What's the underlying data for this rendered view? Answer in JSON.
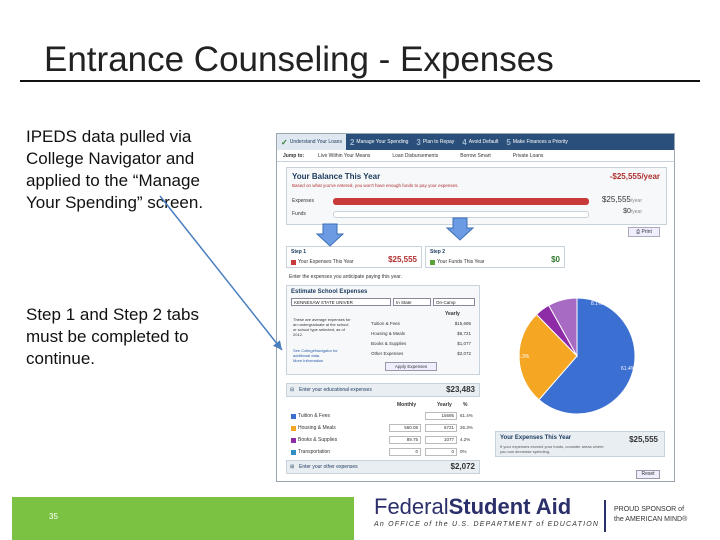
{
  "slide": {
    "title": "Entrance Counseling - Expenses",
    "bullet1": "IPEDS data pulled via College Navigator and applied to the “Manage Your Spending” screen.",
    "bullet2": "Step 1 and Step 2 tabs must be completed to continue.",
    "page_number": "35"
  },
  "footer": {
    "brand_regular": "Federal",
    "brand_bold": "Student Aid",
    "brand_sub": "An OFFICE of the U.S. DEPARTMENT of EDUCATION",
    "sponsor_line1": "PROUD SPONSOR of",
    "sponsor_line2": "the AMERICAN MIND®",
    "green": "#7cc242",
    "navy": "#2b2f6a"
  },
  "screenshot": {
    "steps": [
      {
        "num": "1",
        "label": "Understand Your Loans"
      },
      {
        "num": "2",
        "label": "Manage Your Spending"
      },
      {
        "num": "3",
        "label": "Plan to Repay"
      },
      {
        "num": "4",
        "label": "Avoid Default"
      },
      {
        "num": "5",
        "label": "Make Finances a Priority"
      }
    ],
    "jump": {
      "label": "Jump to:",
      "links": [
        "Live Within Your Means",
        "Loan Disbursements",
        "Borrow Smart",
        "Private Loans"
      ]
    },
    "balance": {
      "title": "Your Balance This Year",
      "subtitle": "Based on what you've entered, you won't have enough funds to pay your expenses.",
      "total": "-$25,555/year",
      "expenses_label": "Expenses",
      "expenses_value": "$25,555",
      "expenses_unit": "/year",
      "funds_label": "Funds",
      "funds_value": "$0",
      "funds_unit": "/year",
      "print": "Print"
    },
    "tabs": {
      "step1_title": "Step 1",
      "step1_label": "Your Expenses This Year",
      "step1_value": "$25,555",
      "step2_title": "Step 2",
      "step2_label": "Your Funds This Year",
      "step2_value": "$0",
      "instructions": "Enter the expenses you anticipate paying this year."
    },
    "estimate": {
      "title": "Estimate School Expenses",
      "school": "KENNESAW STATE UNIVER",
      "residency": "In State",
      "housing": "On-Camp",
      "yearly_header": "Yearly",
      "note": "These are average expenses for an undergraduate at the school or school type selected, as of 2012.",
      "link": "See CollegeNavigator for additional data.",
      "more_link": "More Information",
      "rows": [
        {
          "label": "Tuition & Fees",
          "value": "$15,695"
        },
        {
          "label": "Housing & Meals",
          "value": "$6,721"
        },
        {
          "label": "Books & Supplies",
          "value": "$1,077"
        },
        {
          "label": "Other Expenses",
          "value": "$2,072"
        }
      ],
      "apply": "Apply Expenses"
    },
    "educational": {
      "label": "Enter your educational expenses",
      "total": "$23,483",
      "col_monthly": "Monthly",
      "col_yearly": "Yearly",
      "col_pct": "%",
      "categories": [
        {
          "label": "Tuition & Fees",
          "monthly": "",
          "yearly": "15695",
          "pct": "61.4%",
          "color": "#3b6fd1"
        },
        {
          "label": "Housing & Meals",
          "monthly": "560.08",
          "yearly": "6721",
          "pct": "26.3%",
          "color": "#f5a623"
        },
        {
          "label": "Books & Supplies",
          "monthly": "89.75",
          "yearly": "1077",
          "pct": "4.2%",
          "color": "#8e2ca8"
        },
        {
          "label": "Transportation",
          "monthly": "0",
          "yearly": "0",
          "pct": "0%",
          "color": "#2e8fc4"
        }
      ]
    },
    "other": {
      "label": "Enter your other expenses",
      "total": "$2,072"
    },
    "pie": {
      "slices": [
        {
          "label": "61.4%",
          "value": 61.4,
          "color": "#3b6fd1"
        },
        {
          "label": "26.3%",
          "value": 26.3,
          "color": "#f5a623"
        },
        {
          "label": "4.2%",
          "value": 4.2,
          "color": "#8e2ca8"
        },
        {
          "label": "8.1%",
          "value": 8.1,
          "color": "#a86bc4"
        }
      ]
    },
    "yours": {
      "title": "Your Expenses This Year",
      "value": "$25,555",
      "sub": "If your expenses exceed your funds, consider areas where you can decrease spending."
    },
    "reset": "Reset"
  }
}
